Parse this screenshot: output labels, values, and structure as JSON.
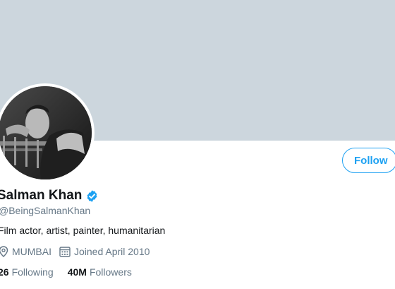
{
  "profile": {
    "name": "Salman Khan",
    "handle": "@BeingSalmanKhan",
    "bio": "Film actor, artist, painter, humanitarian",
    "location": "MUMBAI",
    "joined": "Joined April 2010",
    "verified": true
  },
  "actions": {
    "follow_label": "Follow"
  },
  "stats": {
    "following_count": "26",
    "following_label": "Following",
    "followers_count": "40M",
    "followers_label": "Followers"
  },
  "icons": {
    "verified": "verified-badge-icon",
    "location": "location-pin-icon",
    "calendar": "calendar-icon"
  },
  "colors": {
    "banner": "#ccd6dd",
    "accent": "#1da1f2",
    "text_primary": "#14171a",
    "text_secondary": "#657786"
  }
}
